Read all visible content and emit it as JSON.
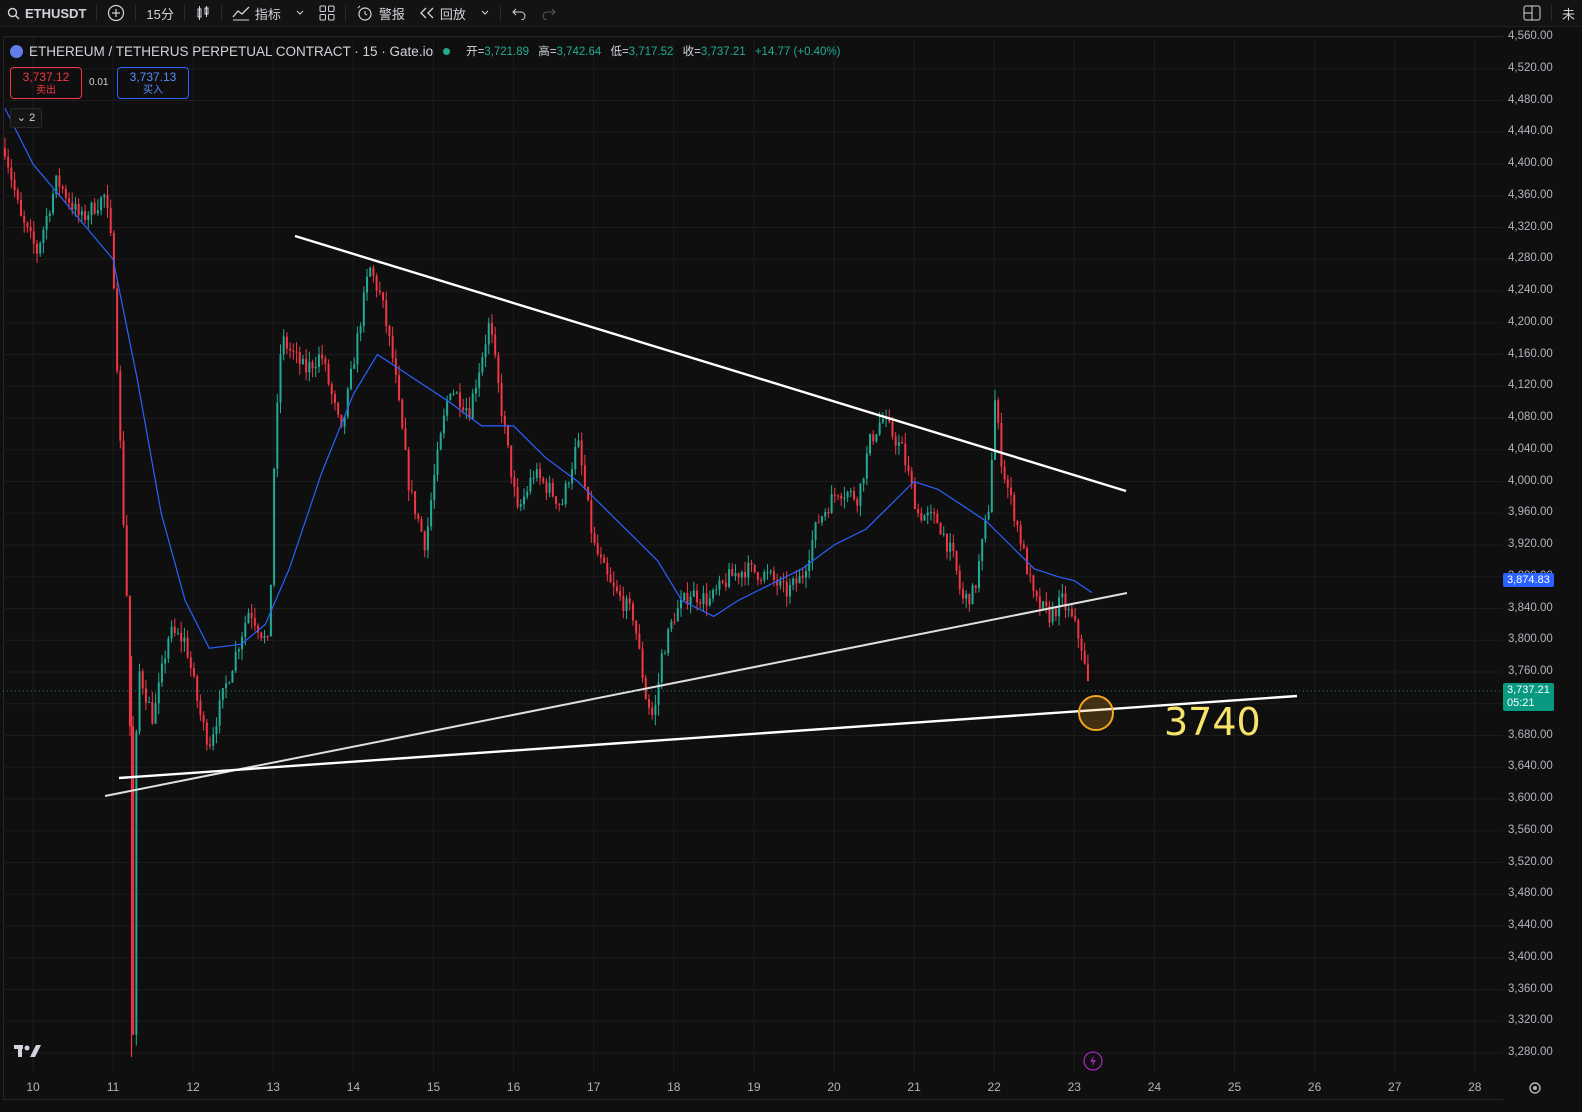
{
  "toolbar": {
    "symbol": "ETHUSDT",
    "interval": "15分",
    "indicators_label": "指标",
    "alert_label": "警报",
    "replay_label": "回放",
    "corner_text": "未"
  },
  "legend": {
    "title": "ETHEREUM / TETHERUS PERPETUAL CONTRACT · 15 · Gate.io",
    "open_label": "开=",
    "open": "3,721.89",
    "high_label": "高=",
    "high": "3,742.64",
    "low_label": "低=",
    "low": "3,717.52",
    "close_label": "收=",
    "close": "3,737.21",
    "change": "+14.77 (+0.40%)"
  },
  "trade": {
    "sell_price": "3,737.12",
    "sell_label": "卖出",
    "spread": "0.01",
    "buy_price": "3,737.13",
    "buy_label": "买入"
  },
  "collapse_count": "2",
  "price_axis": [
    "4,560.00",
    "4,520.00",
    "4,480.00",
    "4,440.00",
    "4,400.00",
    "4,360.00",
    "4,320.00",
    "4,280.00",
    "4,240.00",
    "4,200.00",
    "4,160.00",
    "4,120.00",
    "4,080.00",
    "4,040.00",
    "4,000.00",
    "3,960.00",
    "3,920.00",
    "3,880.00",
    "3,840.00",
    "3,800.00",
    "3,760.00",
    "3,720.00",
    "3,680.00",
    "3,640.00",
    "3,600.00",
    "3,560.00",
    "3,520.00",
    "3,480.00",
    "3,440.00",
    "3,400.00",
    "3,360.00",
    "3,320.00",
    "3,280.00"
  ],
  "time_axis": [
    "10",
    "11",
    "12",
    "13",
    "14",
    "15",
    "16",
    "17",
    "18",
    "19",
    "20",
    "21",
    "22",
    "23",
    "24",
    "25",
    "26",
    "27",
    "28"
  ],
  "badges": {
    "ma_value": "3,874.83",
    "last_price": "3,737.21",
    "countdown": "05:21"
  },
  "annotation": "3740",
  "colors": {
    "up": "#22ab94",
    "down": "#f23645",
    "ma": "#2962ff",
    "trendline": "#ffffff",
    "annotation": "#f8e36a",
    "circle": "#f5a623"
  },
  "chart_data": {
    "type": "candlestick",
    "symbol": "ETHUSDT",
    "interval": "15",
    "x": [
      "10",
      "11",
      "12",
      "13",
      "14",
      "15",
      "16",
      "17",
      "18",
      "19",
      "20",
      "21",
      "22",
      "23"
    ],
    "ylim": [
      3260,
      4560
    ],
    "series": [
      {
        "name": "price",
        "values": [
          4380,
          4330,
          3700,
          3830,
          4180,
          4230,
          4120,
          4050,
          3700,
          3880,
          4010,
          3990,
          4040,
          3737
        ]
      },
      {
        "values": [
          4460,
          4280,
          3950,
          3800,
          4010,
          4160,
          4060,
          3960,
          3810,
          3870,
          3930,
          4000,
          3950,
          3875
        ]
      }
    ],
    "annotation": "3740"
  }
}
